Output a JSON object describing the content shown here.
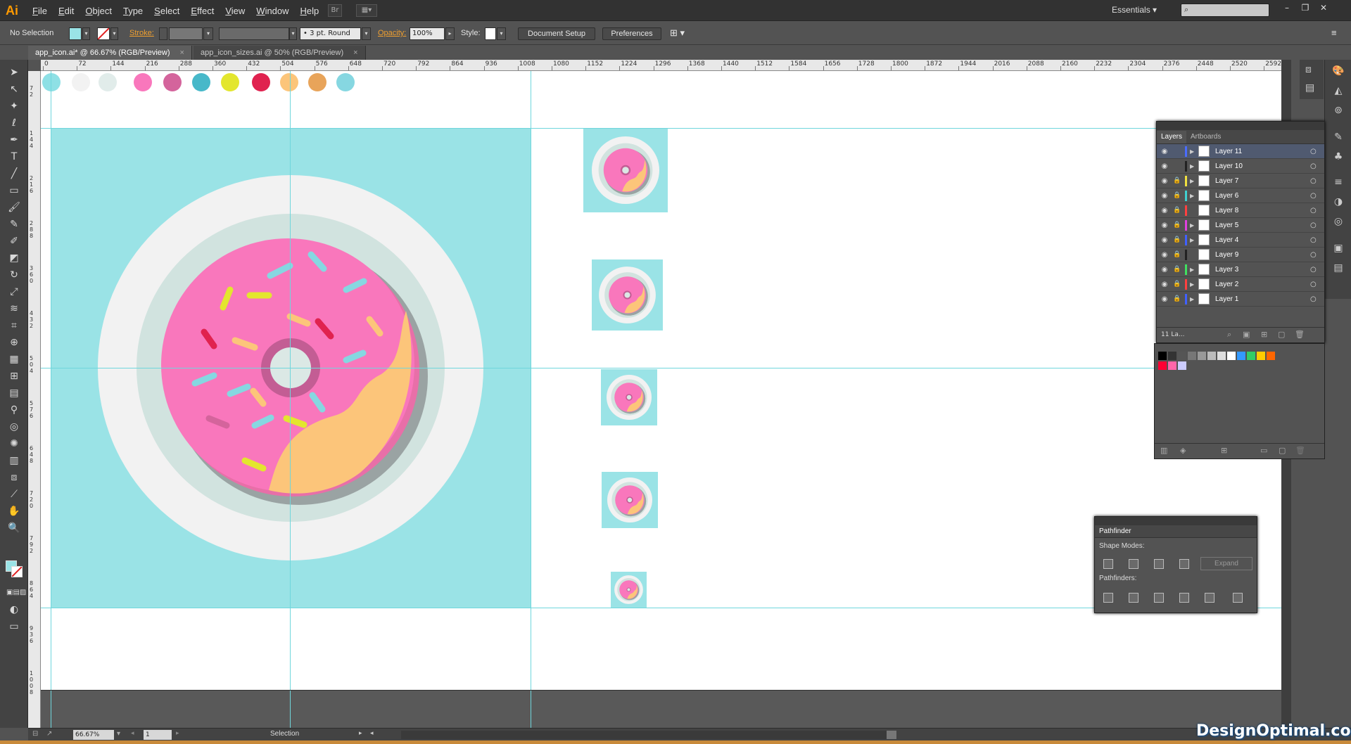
{
  "app": {
    "logo": "Ai"
  },
  "menu": [
    "File",
    "Edit",
    "Object",
    "Type",
    "Select",
    "Effect",
    "View",
    "Window",
    "Help"
  ],
  "menubar": {
    "bridge": "Br",
    "workspace": "Essentials",
    "workspace_caret": "▾"
  },
  "control": {
    "selection": "No Selection",
    "stroke_label": "Stroke:",
    "stroke_profile": "3 pt. Round",
    "opacity_label": "Opacity:",
    "opacity_value": "100%",
    "style_label": "Style:",
    "document_setup": "Document Setup",
    "preferences": "Preferences"
  },
  "tabs": [
    {
      "label": "app_icon.ai* @ 66.67% (RGB/Preview)",
      "close": "×"
    },
    {
      "label": "app_icon_sizes.ai @ 50% (RGB/Preview)",
      "close": "×"
    }
  ],
  "ruler_h": [
    "0",
    "72",
    "144",
    "216",
    "288",
    "360",
    "432",
    "504",
    "576",
    "648",
    "720",
    "792",
    "864",
    "936",
    "1008",
    "1080",
    "1152",
    "1224",
    "1296",
    "1368",
    "1440",
    "1512",
    "1584",
    "1656",
    "1728",
    "1800",
    "1872",
    "1944",
    "2016",
    "2088",
    "2160",
    "2232",
    "2304",
    "2376",
    "2448",
    "2520",
    "2592"
  ],
  "ruler_v": [
    "72",
    "144",
    "216",
    "288",
    "360",
    "432",
    "504",
    "576",
    "648",
    "720",
    "792",
    "864",
    "936",
    "1008"
  ],
  "palette": [
    "#8ee0e5",
    "#f2f2f2",
    "#e1ecea",
    "#f977bc",
    "#d4649c",
    "#47b8c9",
    "#e3e62e",
    "#e0224f",
    "#fcc57a",
    "#e8a45a",
    "#86d7e1"
  ],
  "colors": {
    "bg": "#9ae3e6",
    "plate": "#f2f2f2",
    "rim": "#d1e3df",
    "donut": "#f977bc",
    "icing": "#fcc57a",
    "shadow": "#9aa3a3",
    "accent": "#f0a030"
  },
  "layers": {
    "tabs": [
      "Layers",
      "Artboards"
    ],
    "rows": [
      {
        "name": "Layer 11",
        "color": "#4a6cff",
        "selected": true
      },
      {
        "name": "Layer 10",
        "color": "#222222"
      },
      {
        "name": "Layer 7",
        "color": "#f0e040"
      },
      {
        "name": "Layer 6",
        "color": "#40d0d0"
      },
      {
        "name": "Layer 8",
        "color": "#ff4040"
      },
      {
        "name": "Layer 5",
        "color": "#e040e0"
      },
      {
        "name": "Layer 4",
        "color": "#4060ff"
      },
      {
        "name": "Layer 9",
        "color": "#222222"
      },
      {
        "name": "Layer 3",
        "color": "#40e060"
      },
      {
        "name": "Layer 2",
        "color": "#ff4040"
      },
      {
        "name": "Layer 1",
        "color": "#4060ff"
      }
    ],
    "count": "11 La..."
  },
  "swatches": [
    "#000000",
    "#333333",
    "#555555",
    "#777777",
    "#999999",
    "#bbbbbb",
    "#dddddd",
    "#ffffff",
    "#3399ff",
    "#33cc66",
    "#ffcc00",
    "#ff6600",
    "#ff0033",
    "#ff66aa",
    "#ccccff"
  ],
  "pathfinder": {
    "title": "Pathfinder",
    "shape_modes": "Shape Modes:",
    "pathfinders": "Pathfinders:",
    "expand": "Expand"
  },
  "status": {
    "zoom": "66.67%",
    "page": "1",
    "tool": "Selection"
  },
  "watermark": "DesignOptimal.com"
}
